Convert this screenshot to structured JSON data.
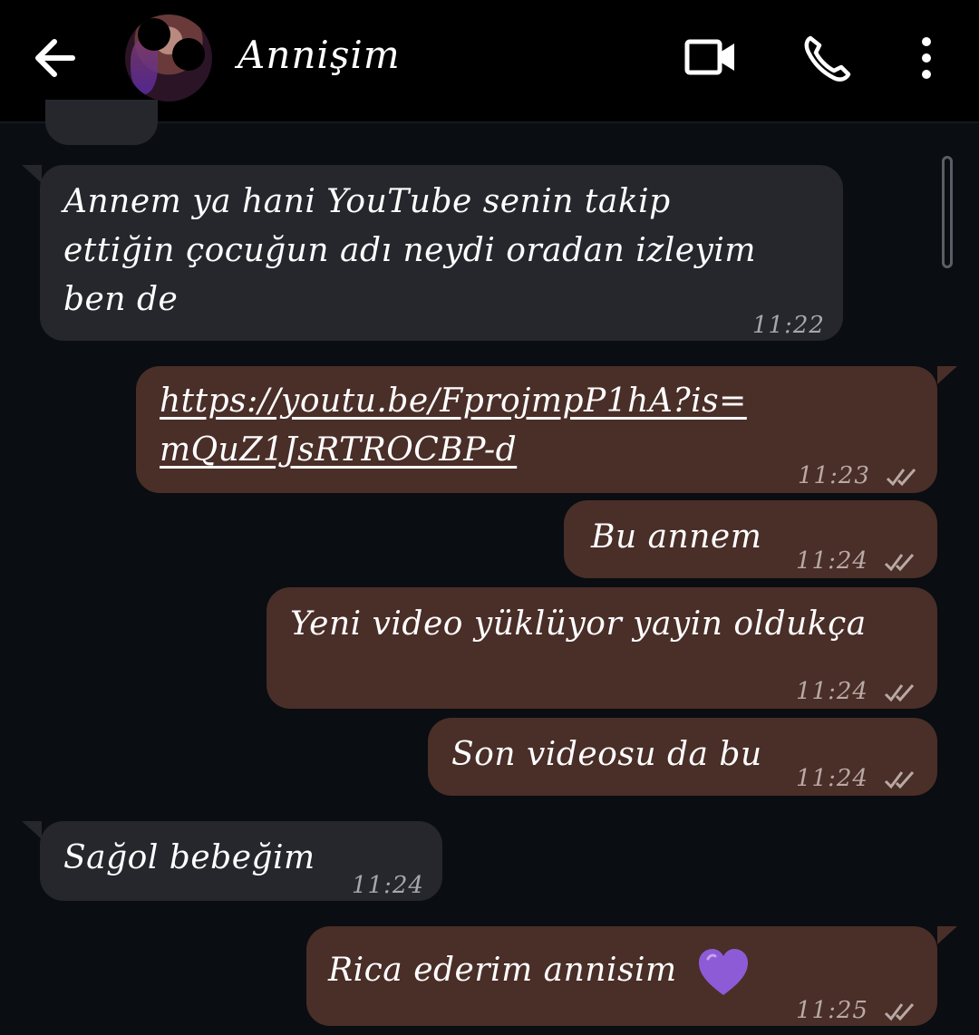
{
  "header": {
    "contact_name": "Annişim",
    "back_icon": "arrow-left-icon",
    "video_icon": "video-call-icon",
    "call_icon": "phone-icon",
    "menu_icon": "more-vertical-icon"
  },
  "colors": {
    "background": "#0a0d12",
    "header": "#000000",
    "incoming_bubble": "#25272c",
    "outgoing_bubble": "#4a2e28",
    "heart": "#8e5bd6"
  },
  "messages": [
    {
      "direction": "incoming",
      "lines": [
        "Annem ya hani YouTube senin takip",
        "ettiğin çocuğun adı neydi oradan izleyim",
        "ben de"
      ],
      "time": "11:22"
    },
    {
      "direction": "outgoing",
      "lines": [
        "https://youtu.be/FprojmpP1hA?is=",
        "mQuZ1JsRTROCBP-d"
      ],
      "is_link": true,
      "time": "11:23",
      "status": "read"
    },
    {
      "direction": "outgoing",
      "lines": [
        "Bu annem"
      ],
      "time": "11:24",
      "status": "read"
    },
    {
      "direction": "outgoing",
      "lines": [
        "Yeni video yüklüyor yayin oldukça"
      ],
      "time": "11:24",
      "status": "read"
    },
    {
      "direction": "outgoing",
      "lines": [
        "Son videosu da bu"
      ],
      "time": "11:24",
      "status": "read"
    },
    {
      "direction": "incoming",
      "lines": [
        "Sağol bebeğim"
      ],
      "time": "11:24"
    },
    {
      "direction": "outgoing",
      "lines": [
        "Rica ederim annisim"
      ],
      "emoji": "purple-heart",
      "time": "11:25",
      "status": "read"
    }
  ]
}
